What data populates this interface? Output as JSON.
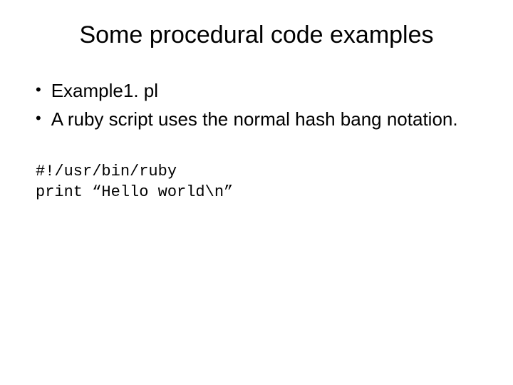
{
  "title": "Some procedural code examples",
  "bullets": [
    "Example1. pl",
    "A ruby script uses the normal hash bang notation."
  ],
  "code": [
    "#!/usr/bin/ruby",
    "print “Hello world\\n”"
  ]
}
